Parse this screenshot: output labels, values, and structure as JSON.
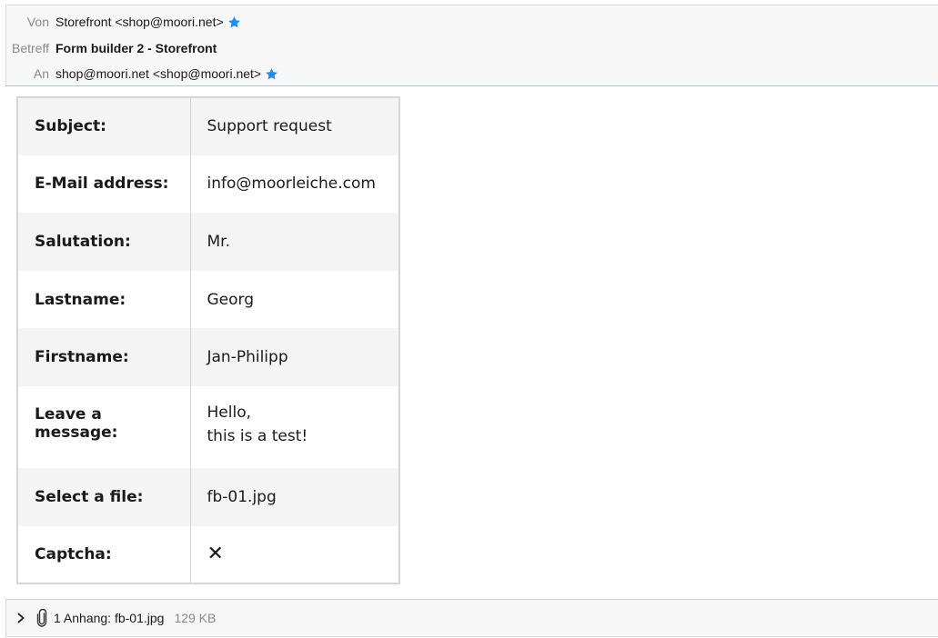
{
  "header": {
    "from_label": "Von",
    "from_value": "Storefront <shop@moori.net>",
    "subject_label": "Betreff",
    "subject_value": "Form builder 2 - Storefront",
    "to_label": "An",
    "to_value": "shop@moori.net <shop@moori.net>",
    "star_icon": "star-icon",
    "star_color": "#1a8cff"
  },
  "form": {
    "rows": [
      {
        "label": "Subject:",
        "value": "Support request"
      },
      {
        "label": "E-Mail address:",
        "value": "info@moorleiche.com"
      },
      {
        "label": "Salutation:",
        "value": "Mr."
      },
      {
        "label": "Lastname:",
        "value": "Georg"
      },
      {
        "label": "Firstname:",
        "value": "Jan-Philipp"
      },
      {
        "label": "Leave a message:",
        "value_lines": [
          "Hello,",
          "this is a test!"
        ]
      },
      {
        "label": "Select a file:",
        "value": "fb-01.jpg"
      },
      {
        "label": "Captcha:",
        "value": "✕"
      }
    ]
  },
  "attachments": {
    "label": "1 Anhang: fb-01.jpg",
    "size": "129 KB",
    "expand_icon": "chevron-right-icon",
    "clip_icon": "paperclip-icon"
  }
}
